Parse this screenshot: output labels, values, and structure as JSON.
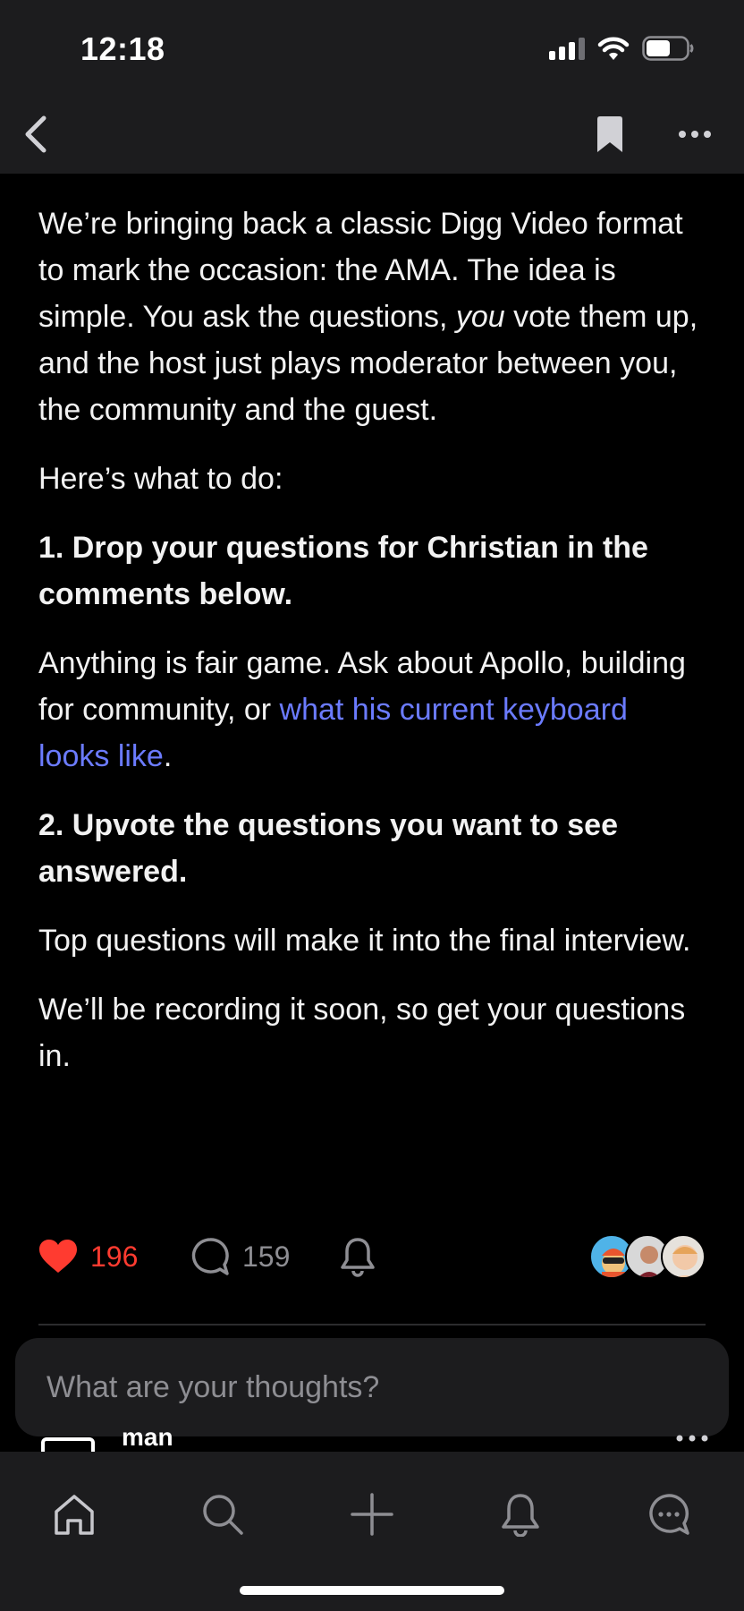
{
  "status_bar": {
    "time": "12:18",
    "icons": [
      "cellular-signal-icon",
      "wifi-icon",
      "battery-icon"
    ],
    "battery_level": 0.6
  },
  "navbar": {
    "icons": [
      "chevron-left-icon",
      "bookmark-icon",
      "more-horizontal-icon"
    ]
  },
  "article": {
    "p1_text": "We’re bringing back a classic Digg Video format to mark the occasion: the AMA. The idea is simple. You ask the questions, ",
    "p1_em": "you",
    "p1_tail": " vote them up, and the host just plays moderator between you, the community and the guest.",
    "p2": "Here’s what to do:",
    "step1": "1. Drop your questions for Christian in the comments below.",
    "p3_text": "Anything is fair game. Ask about Apollo, building for community, or ",
    "p3_link": "what his current keyboard looks like",
    "p3_tail": ".",
    "step2": "2. Upvote the questions you want to see answered.",
    "p4": "Top questions will make it into the final interview.",
    "p5": "We’ll be recording it soon, so get your questions in."
  },
  "actions": {
    "likes": "196",
    "comments": "159",
    "icons": [
      "heart-icon",
      "comment-icon",
      "bell-icon"
    ]
  },
  "comment_box": {
    "placeholder": "What are your thoughts?"
  },
  "peek_comment": {
    "name": "man"
  },
  "tab_bar": {
    "icons": [
      "home-icon",
      "search-icon",
      "plus-icon",
      "notifications-icon",
      "messages-icon"
    ]
  },
  "colors": {
    "background": "#000000",
    "chrome": "#1c1c1e",
    "text": "#f2f2f2",
    "link": "#6b7bff",
    "like": "#ff3b30",
    "muted": "#8e8e93"
  }
}
